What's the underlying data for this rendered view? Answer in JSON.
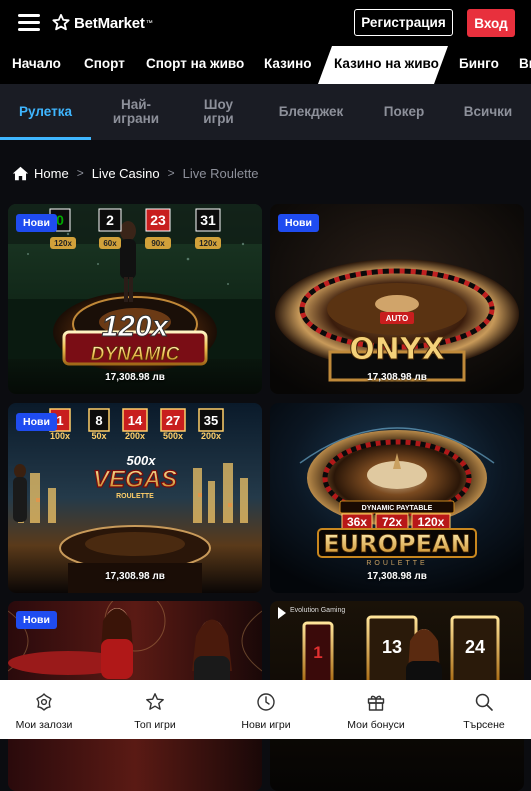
{
  "header": {
    "logo_text": "BetMarket",
    "logo_tm": "™",
    "register_label": "Регистрация",
    "login_label": "Вход"
  },
  "main_nav": {
    "items": [
      {
        "label": "Начало"
      },
      {
        "label": "Спорт"
      },
      {
        "label": "Спорт на живо"
      },
      {
        "label": "Казино"
      },
      {
        "label": "Казино на живо",
        "active": true
      },
      {
        "label": "Бинго"
      },
      {
        "label": "Ви"
      }
    ]
  },
  "sub_tabs": {
    "items": [
      {
        "label": "Рулетка",
        "active": true
      },
      {
        "line1": "Най-",
        "line2": "играни"
      },
      {
        "line1": "Шоу",
        "line2": "игри"
      },
      {
        "label": "Блекджек"
      },
      {
        "label": "Покер"
      },
      {
        "label": "Всички"
      }
    ]
  },
  "breadcrumb": {
    "home": "Home",
    "separator": ">",
    "section": "Live Casino",
    "current": "Live Roulette"
  },
  "games": [
    {
      "badge": "Нови",
      "jackpot": "17,308.98 лв",
      "art_title": "120x",
      "art_subtitle": "DYNAMIC",
      "numbers": [
        "0",
        "2",
        "23",
        "31"
      ],
      "multipliers": [
        "120x",
        "60x",
        "90x",
        "120x"
      ]
    },
    {
      "badge": "Нови",
      "jackpot": "17,308.98 лв",
      "art_title": "ONYX",
      "art_subtitle": "AUTO"
    },
    {
      "badge": "Нови",
      "jackpot": "17,308.98 лв",
      "art_title": "VEGAS",
      "art_subtitle": "500x",
      "art_caption": "ROULETTE",
      "numbers": [
        "1",
        "8",
        "14",
        "27",
        "35"
      ],
      "multipliers": [
        "100x",
        "50x",
        "200x",
        "500x",
        "200x"
      ]
    },
    {
      "badge": "",
      "jackpot": "17,308.98 лв",
      "art_title": "EUROPEAN",
      "art_subtitle": "DYNAMIC PAYTABLE",
      "art_caption": "ROULETTE",
      "multipliers": [
        "36x",
        "72x",
        "120x"
      ]
    },
    {
      "badge": "Нови",
      "jackpot": ""
    },
    {
      "badge": "",
      "jackpot": "",
      "provider": "Evolution Gaming",
      "numbers": [
        "1",
        "13",
        "24"
      ]
    }
  ],
  "bottom_nav": {
    "items": [
      {
        "label": "Мои залози",
        "icon": "bets-icon"
      },
      {
        "label": "Топ игри",
        "icon": "star-icon"
      },
      {
        "label": "Нови игри",
        "icon": "clock-icon"
      },
      {
        "label": "Мои бонуси",
        "icon": "gift-icon"
      },
      {
        "label": "Търсене",
        "icon": "search-icon"
      }
    ]
  },
  "colors": {
    "accent_blue": "#3fb6ff",
    "badge_blue": "#1f4cf0",
    "login_red": "#e8303d"
  }
}
